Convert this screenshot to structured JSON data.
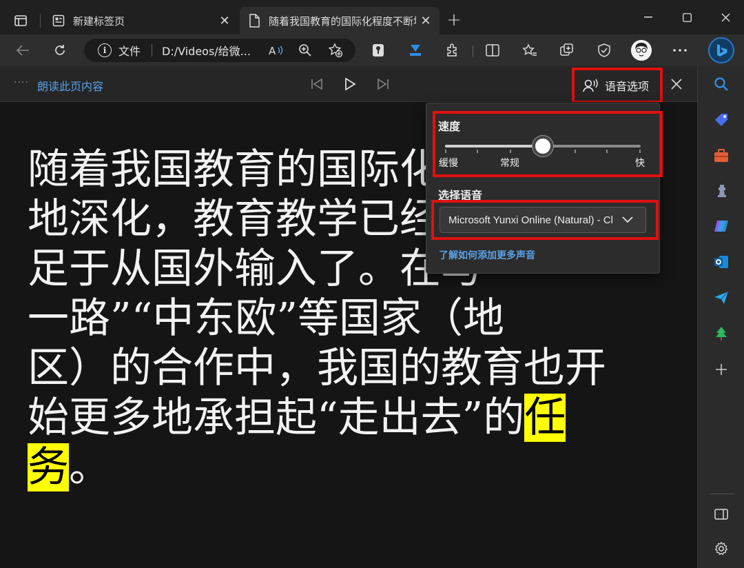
{
  "tabs": [
    {
      "title": "新建标签页",
      "active": false
    },
    {
      "title": "随着我国教育的国际化程度不断地",
      "active": true
    }
  ],
  "address_bar": {
    "scheme_label": "文件",
    "url": "D:/Videos/给微..."
  },
  "read_aloud": {
    "title": "朗读此页内容",
    "voice_options_label": "语音选项"
  },
  "voice_panel": {
    "speed_title": "速度",
    "speed_labels": {
      "slow": "缓慢",
      "normal": "常规",
      "fast": "快"
    },
    "speed_level": 0.5,
    "language_title": "选择语音",
    "selected_voice": "Microsoft Yunxi Online (Natural) - Chinese (Mainland)",
    "learn_more_link": "了解如何添加更多声音"
  },
  "article": {
    "lines": [
      "随着我国教育的国际化",
      "地深化，教育教学已经",
      "足于从国外输入了。在与",
      "一路”“中东欧”等国家（地",
      "区）的合作中，我国的教育也开",
      "始更多地承担起“走出去”的"
    ],
    "highlighted_word_part1": "任",
    "highlighted_word_part2": "务",
    "trailing": "。"
  },
  "colors": {
    "highlight": "#ffff00",
    "annotation": "#e01010",
    "link": "#5aa2e8"
  }
}
